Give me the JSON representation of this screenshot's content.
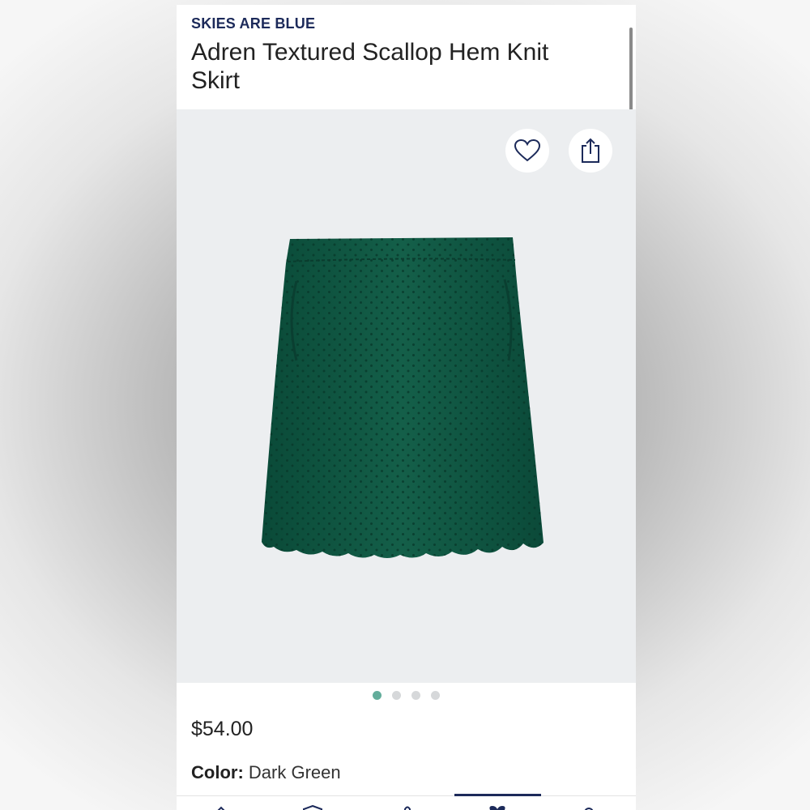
{
  "product": {
    "brand": "SKIES ARE BLUE",
    "title": "Adren Textured Scallop Hem Knit Skirt",
    "price": "$54.00",
    "color_label": "Color:",
    "color_value": "Dark Green",
    "image_alt": "dark green textured knit skirt with scallop hem"
  },
  "actions": {
    "favorite_icon": "heart-icon",
    "share_icon": "share-icon"
  },
  "carousel": {
    "page_count": 4,
    "active_index": 0
  },
  "bottom_nav": {
    "items": [
      "home-icon",
      "shield-icon",
      "bag-icon",
      "heart-icon",
      "profile-icon"
    ],
    "active_index": 3
  },
  "colors": {
    "brand_navy": "#1c2a5a",
    "accent_teal": "#63ad9b",
    "skirt_green": "#0f5a45",
    "image_background": "#eceef0"
  }
}
